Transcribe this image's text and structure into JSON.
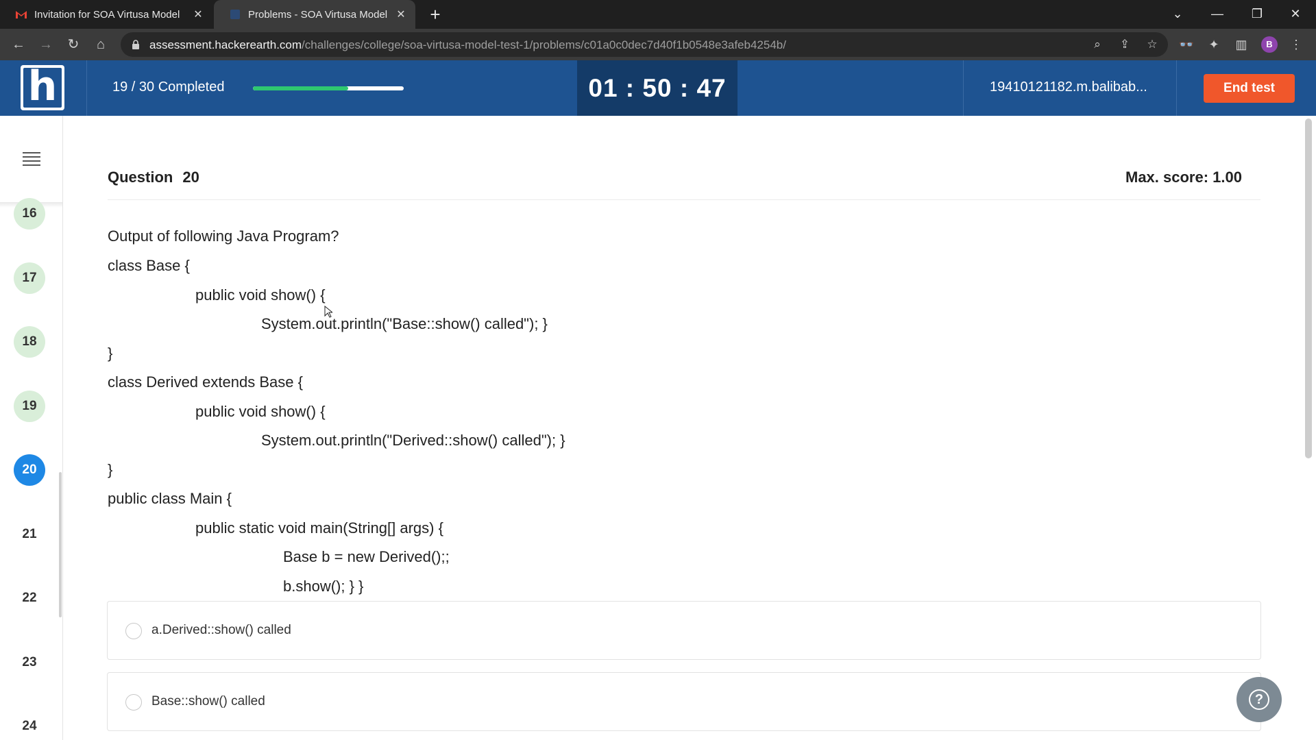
{
  "browser": {
    "tabs": [
      {
        "title": "Invitation for SOA Virtusa Model",
        "icon": "gmail-icon"
      },
      {
        "title": "Problems - SOA Virtusa Model Te",
        "icon": "hackerearth-icon"
      }
    ],
    "new_tab": "+",
    "url_host": "assessment.hackerearth.com",
    "url_path": "/challenges/college/soa-virtusa-model-test-1/problems/c01a0c0dec7d40f1b0548e3afeb4254b/",
    "profile_initial": "B"
  },
  "header": {
    "logo": "h",
    "completed_text": "19 / 30 Completed",
    "completed": 19,
    "total": 30,
    "timer": "01 : 50 : 47",
    "username": "19410121182.m.balibab...",
    "end_test": "End test"
  },
  "sidebar": {
    "questions": [
      {
        "num": "16",
        "state": "done"
      },
      {
        "num": "17",
        "state": "done"
      },
      {
        "num": "18",
        "state": "done"
      },
      {
        "num": "19",
        "state": "done"
      },
      {
        "num": "20",
        "state": "current"
      },
      {
        "num": "21",
        "state": "pending"
      },
      {
        "num": "22",
        "state": "pending"
      },
      {
        "num": "23",
        "state": "pending"
      },
      {
        "num": "24",
        "state": "pending"
      }
    ]
  },
  "question": {
    "label": "Question",
    "number": "20",
    "max_score": "Max. score: 1.00",
    "lines": [
      "Output of following Java Program?",
      "class Base {",
      "public void show() {",
      "System.out.println(\"Base::show() called\"); }",
      "}",
      "class Derived extends Base {",
      "public void show() {",
      "System.out.println(\"Derived::show() called\"); }",
      "}",
      "public class Main {",
      "public static void main(String[] args) {",
      "Base b = new Derived();;",
      "b.show(); } }"
    ],
    "options": [
      "a.Derived::show() called",
      "Base::show() called"
    ]
  },
  "colors": {
    "header_bg": "#1e5391",
    "timer_bg": "#143b68",
    "end_test": "#f0572b",
    "current_question": "#1e88e5",
    "done_question": "#d9eed9"
  }
}
